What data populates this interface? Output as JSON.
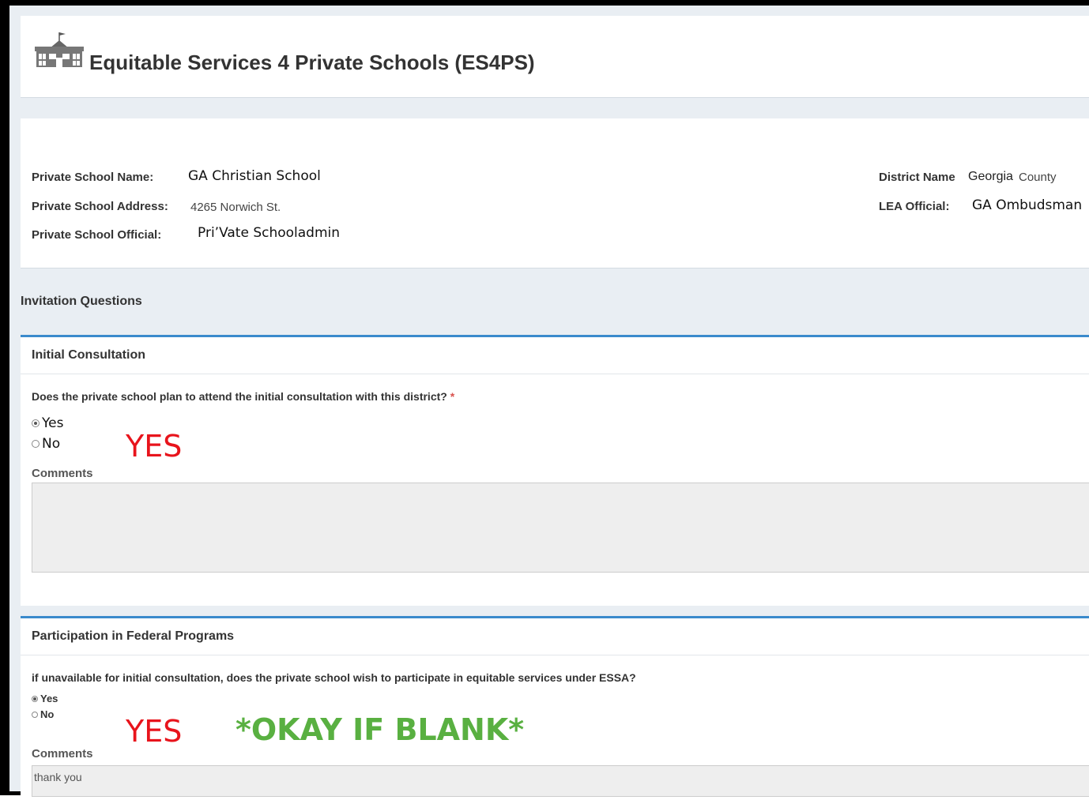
{
  "header": {
    "logo_icon": "school-building-icon",
    "title": "Equitable Services 4 Private Schools (ES4PS)"
  },
  "school_info": {
    "name_label": "Private School Name:",
    "name_value": "GA Christian School",
    "address_label": "Private School Address:",
    "address_value": "4265 Norwich St.",
    "official_label": "Private School Official:",
    "official_value": "Pri’Vate Schooladmin",
    "district_label": "District Name",
    "district_value_1": "Georgia",
    "district_value_2": "County",
    "lea_label": "LEA Official:",
    "lea_value": "GA Ombudsman"
  },
  "section_title": "Invitation Questions",
  "initial_consultation": {
    "title": "Initial Consultation",
    "question": "Does the private school plan to attend the initial consultation with this district?",
    "required_mark": "*",
    "options": [
      {
        "label": "Yes",
        "selected": true
      },
      {
        "label": "No",
        "selected": false
      }
    ],
    "comments_label": "Comments",
    "comments_value": "",
    "annotation": "YES"
  },
  "federal_programs": {
    "title": "Participation in Federal Programs",
    "question": "if unavailable for initial consultation, does the private school wish to participate in equitable services under ESSA?",
    "options": [
      {
        "label": "Yes",
        "selected": true
      },
      {
        "label": "No",
        "selected": false
      }
    ],
    "comments_label": "Comments",
    "comments_value": "thank you",
    "annotation_red": "YES",
    "annotation_green": "*OKAY IF BLANK*"
  },
  "colors": {
    "accent_border": "#3a8acc",
    "annotation_red": "#e8141c",
    "annotation_green": "#59b041"
  }
}
